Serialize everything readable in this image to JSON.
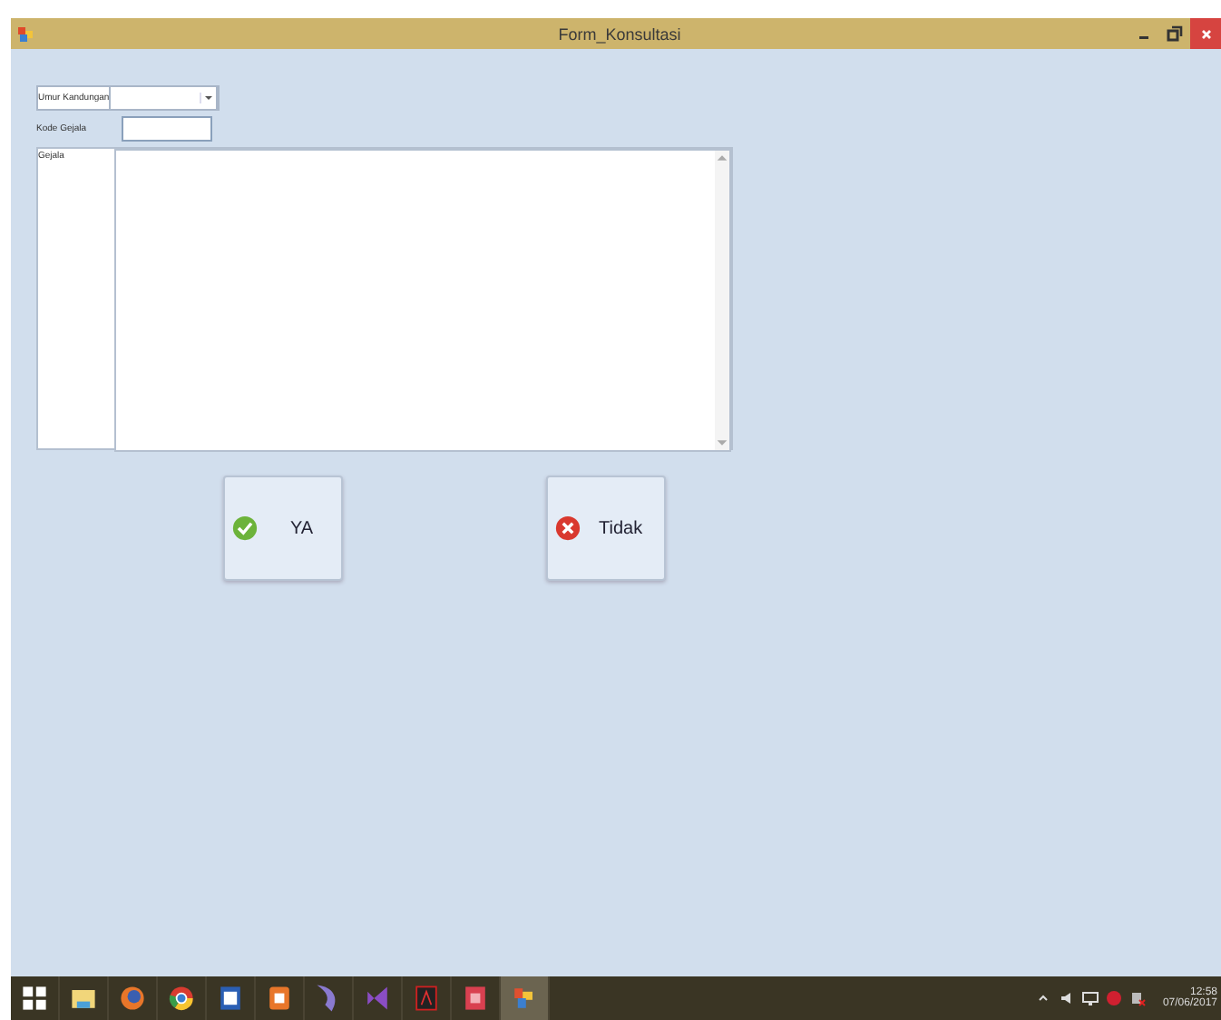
{
  "window": {
    "title": "Form_Konsultasi"
  },
  "fields": [
    {
      "label": "Umur Kandungan",
      "kind": "combo"
    },
    {
      "label": "Kode Gejala",
      "kind": "text"
    },
    {
      "label": "Gejala",
      "kind": "memo"
    }
  ],
  "buttons": [
    {
      "label": "YA",
      "kind": "ok"
    },
    {
      "label": "Tidak",
      "kind": "cancel"
    }
  ],
  "taskbar": {
    "clock": "12:58",
    "date": "07/06/2017"
  }
}
